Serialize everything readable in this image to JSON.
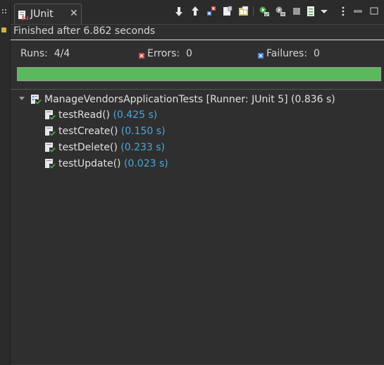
{
  "tab": {
    "label": "JUnit",
    "close_glyph": "✕"
  },
  "toolbar": {
    "buttons": [
      {
        "name": "next-failure-icon"
      },
      {
        "name": "previous-failure-icon"
      },
      {
        "name": "show-failures-only-icon"
      },
      {
        "name": "scroll-lock-icon"
      },
      {
        "name": "show-skipped-icon"
      },
      {
        "name": "rerun-test-icon"
      },
      {
        "name": "rerun-failed-first-icon"
      },
      {
        "name": "stop-icon"
      },
      {
        "name": "test-run-history-icon"
      },
      {
        "name": "history-dropdown-icon"
      },
      {
        "name": "view-menu-icon"
      },
      {
        "name": "minimize-icon"
      },
      {
        "name": "maximize-icon"
      }
    ]
  },
  "status": "Finished after 6.862 seconds",
  "counters": {
    "runs_label": "Runs:",
    "runs_value": "4/4",
    "errors_label": "Errors:",
    "errors_value": "0",
    "failures_label": "Failures:",
    "failures_value": "0"
  },
  "progress": {
    "fraction": 1.0,
    "color": "#5cb85c"
  },
  "tree": {
    "root": {
      "label": "ManageVendorsApplicationTests [Runner: JUnit 5] (0.836 s)"
    },
    "tests": [
      {
        "name": "testRead()",
        "time": "(0.425 s)"
      },
      {
        "name": "testCreate()",
        "time": "(0.150 s)"
      },
      {
        "name": "testDelete()",
        "time": "(0.233 s)"
      },
      {
        "name": "testUpdate()",
        "time": "(0.023 s)"
      }
    ]
  },
  "colors": {
    "background": "#2f2f2f",
    "time_text": "#4aa8d8",
    "success": "#5cb85c",
    "error_red": "#d64545",
    "failure_blue": "#4a7fd4"
  }
}
